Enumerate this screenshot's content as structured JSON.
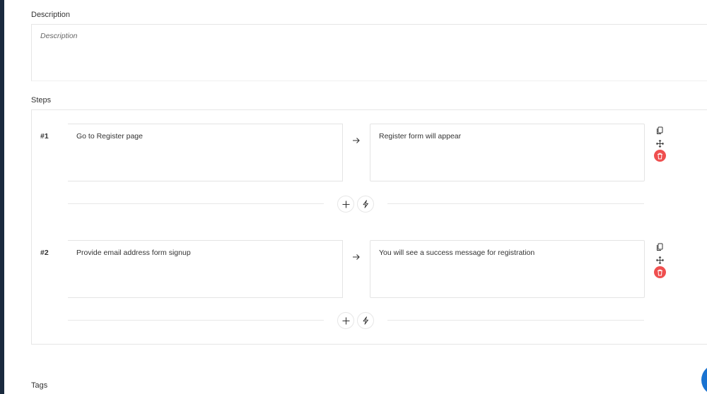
{
  "description": {
    "label": "Description",
    "placeholder": "Description",
    "value": ""
  },
  "steps": {
    "label": "Steps",
    "items": [
      {
        "number": "#1",
        "action": "Go to Register page",
        "expected": "Register form will appear"
      },
      {
        "number": "#2",
        "action": "Provide email address form signup",
        "expected": "You will see a success message for registration"
      }
    ]
  },
  "tags": {
    "label": "Tags"
  },
  "colors": {
    "delete": "#ef4f4f",
    "sidebar": "#1a2a3e",
    "chat": "#1a73d1"
  },
  "icons": [
    "copy-icon",
    "move-icon",
    "delete-icon",
    "arrow-right-icon",
    "plus-icon",
    "lightning-icon"
  ]
}
